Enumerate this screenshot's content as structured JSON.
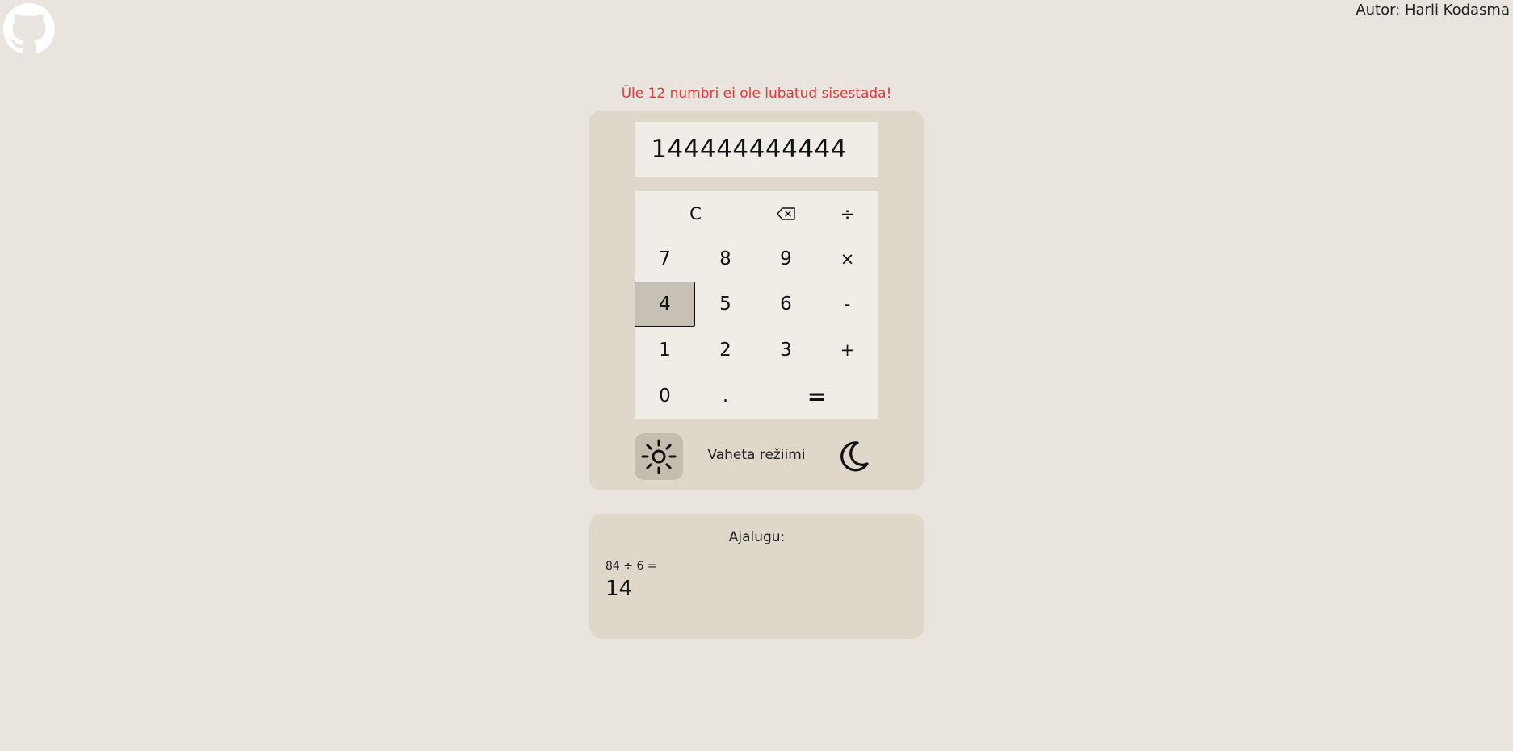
{
  "header": {
    "github_icon": "github-icon",
    "author": "Autor: Harli Kodasma"
  },
  "error_message": "Üle 12 numbri ei ole lubatud sisestada!",
  "calculator": {
    "display_value": "144444444444",
    "keys": {
      "clear": "C",
      "backspace_icon": "backspace-icon",
      "divide": "÷",
      "seven": "7",
      "eight": "8",
      "nine": "9",
      "multiply": "×",
      "four": "4",
      "five": "5",
      "six": "6",
      "minus": "-",
      "one": "1",
      "two": "2",
      "three": "3",
      "plus": "+",
      "zero": "0",
      "decimal": ".",
      "equals": "="
    },
    "active_key": "4",
    "mode": {
      "label": "Vaheta režiimi",
      "light_icon": "sun-icon",
      "dark_icon": "moon-icon",
      "selected": "light"
    }
  },
  "history": {
    "title": "Ajalugu:",
    "entries": [
      {
        "expression": "84 ÷ 6 =",
        "result": "14"
      }
    ]
  },
  "colors": {
    "background": "#e9e5de",
    "panel": "#dfd7ca",
    "inner": "#f0ede7",
    "active_key": "#c7c0b4",
    "error": "#e13a3a"
  }
}
